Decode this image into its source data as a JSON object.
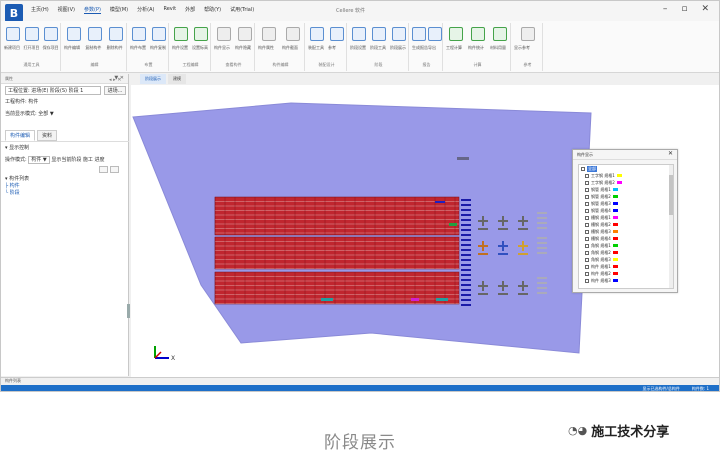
{
  "titlebar": {
    "logo": "B",
    "menu": [
      "主页(H)",
      "视图(V)",
      "参数(P)",
      "模型(M)",
      "分析(A)",
      "Revit",
      "外部",
      "帮助(Y)",
      "试用(Trial)"
    ],
    "active_menu": 2,
    "window_title": "Cellere 软件",
    "minimize": "–",
    "maximize": "▫",
    "close": "✕"
  },
  "ribbon": {
    "groups": [
      {
        "name": "通用工具",
        "buttons": [
          "新建项目",
          "打开项目",
          "保存项目"
        ]
      },
      {
        "name": "编辑",
        "buttons": [
          "构件编辑",
          "复制构件",
          "删除构件"
        ]
      },
      {
        "name": "布置",
        "buttons": [
          "构件布置",
          "构件复制"
        ]
      },
      {
        "name": "工程编辑",
        "buttons": [
          "构件设置",
          "设置标高"
        ]
      },
      {
        "name": "查看构件",
        "buttons": [
          "构件显示",
          "构件隐藏"
        ]
      },
      {
        "name": "构件编辑",
        "buttons": [
          "构件属性",
          "构件截面"
        ]
      },
      {
        "name": "装配设计",
        "buttons": [
          "装配工具",
          "参考"
        ]
      },
      {
        "name": "阶段",
        "buttons": [
          "阶段设置",
          "阶段工具",
          "阶段展示"
        ]
      },
      {
        "name": "报告",
        "buttons": [
          "生成报告",
          "导出"
        ]
      },
      {
        "name": "计算",
        "buttons": [
          "工程计算",
          "构件统计",
          "材料用量"
        ]
      },
      {
        "name": "参考",
        "buttons": [
          "显示参考"
        ]
      }
    ]
  },
  "left_panel": {
    "header": "属性",
    "pin": "▼ ✕",
    "project_label": "工程位置: 进场(E) 阶段(S) 阶段 1",
    "project_btn": "进场...",
    "floor_label": "工程构件: 构件",
    "show_label": "当前显示模式: 全部 ▼",
    "tabs": [
      "构件编辑",
      "资料"
    ],
    "active_tab": 0,
    "section_title": "▾ 显示控制",
    "filter_label": "操作模式:",
    "filter_value": "构件 ▼",
    "filter_option": "显示当前阶段 施工 进度",
    "tree": [
      "▾ 构件列表",
      "  ├ 构件",
      "  └ 阶段"
    ],
    "bottom_label": "▸ 属性列表"
  },
  "doc_tabs": {
    "controls": "◂ ▸ ✕",
    "tabs": [
      "阶段展示",
      "建模"
    ],
    "active": 0
  },
  "layer_panel": {
    "title": "构件显示",
    "close": "✕",
    "root": "全部",
    "items": [
      {
        "label": "工字钢 规格1",
        "color": "#ffff00"
      },
      {
        "label": "工字钢 规格2",
        "color": "#ff00ff"
      },
      {
        "label": "钢管 规格1",
        "color": "#00c0ff"
      },
      {
        "label": "钢管 规格2",
        "color": "#00d000"
      },
      {
        "label": "钢管 规格3",
        "color": "#0000ff"
      },
      {
        "label": "钢管 规格4",
        "color": "#0000ff"
      },
      {
        "label": "槽钢 规格1",
        "color": "#ff00ff"
      },
      {
        "label": "槽钢 规格2",
        "color": "#ff0000"
      },
      {
        "label": "槽钢 规格3",
        "color": "#ff8000"
      },
      {
        "label": "槽钢 规格4",
        "color": "#ff0000"
      },
      {
        "label": "角钢 规格1",
        "color": "#00d000"
      },
      {
        "label": "角钢 规格2",
        "color": "#ff0000"
      },
      {
        "label": "角钢 规格3",
        "color": "#ffff00"
      },
      {
        "label": "构件 规格1",
        "color": "#ff0000"
      },
      {
        "label": "构件 规格2",
        "color": "#ff0000"
      },
      {
        "label": "构件 规格3",
        "color": "#0000ff"
      }
    ]
  },
  "viewport": {
    "ground_color": "#9898e6",
    "block_color": "#c0262f",
    "axis_z": "Z",
    "axis_x": "X"
  },
  "status": {
    "left": "构件列表",
    "right_items": [
      "显示已选构件/总构件",
      "构件数: 1"
    ]
  },
  "caption": "阶段展示",
  "watermark": {
    "icon": "wechat-icon",
    "text": "施工技术分享"
  }
}
